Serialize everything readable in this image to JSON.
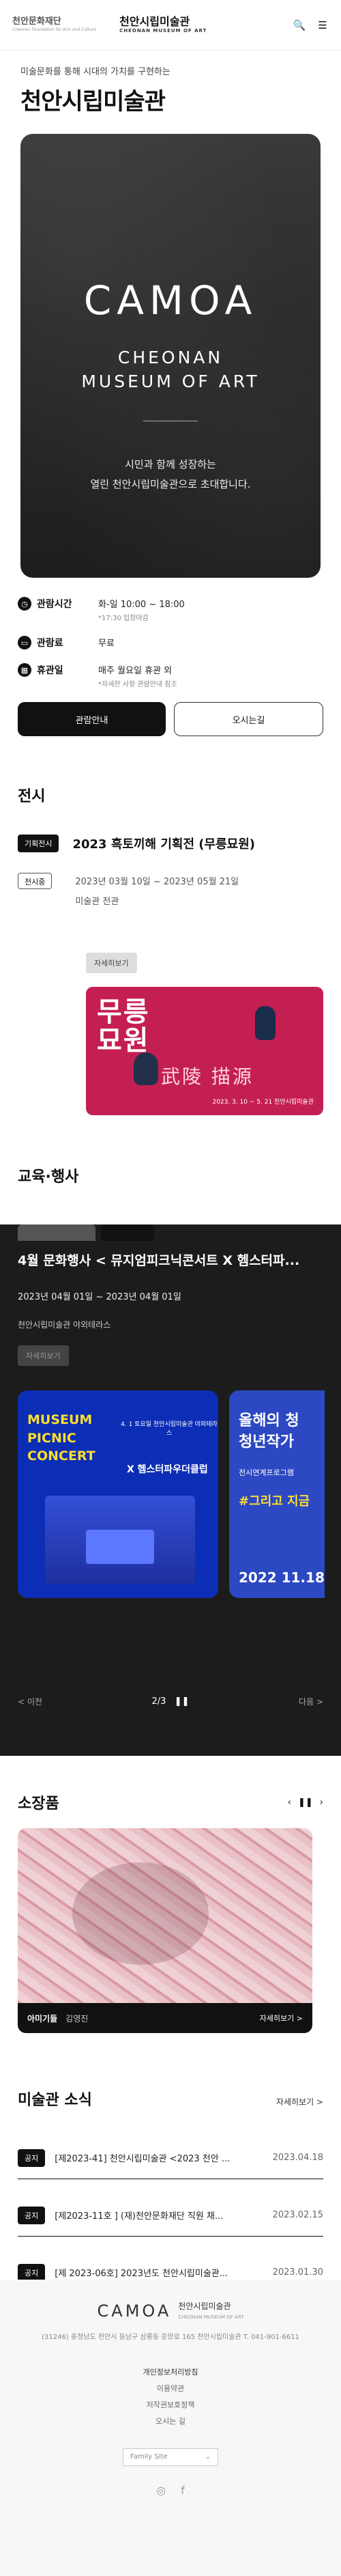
{
  "header": {
    "org_name": "천안문화재단",
    "org_sub": "Cheonan Foundation for Arts and Culture",
    "museum_name": "천안시립미술관",
    "museum_sub": "CHEONAN MUSEUM OF ART",
    "search_icon": "🔍",
    "menu_icon": "☰"
  },
  "hero": {
    "subtitle": "미술문화를 통해 시대의 가치를 구현하는",
    "title": "천안시립미술관",
    "brand": "CAMOA",
    "brand_line1": "CHEONAN",
    "brand_line2": "MUSEUM OF ART",
    "message_line1": "시민과 함께 성장하는",
    "message_line2": "열린 천안시립미술관으로 초대합니다."
  },
  "info": {
    "hours_label": "관람시간",
    "hours_value": "화-일 10:00 ~ 18:00",
    "hours_note": "*17:30 입장마감",
    "fee_label": "관람료",
    "fee_value": "무료",
    "closed_label": "휴관일",
    "closed_value": "매주 월요일 휴관 외",
    "closed_note": "*자세한 사항 관람안내 참조",
    "guide_button": "관람안내",
    "map_button": "오시는길"
  },
  "exhibition": {
    "section_title": "전시",
    "type_tag": "기획전시",
    "title": "2023 흑토끼해 기획전 (무릉묘원)",
    "status_tag": "전시중",
    "period": "2023년 03월 10일 ~ 2023년 05월 21일",
    "venue": "미술관 전관",
    "more_button": "자세히보기",
    "poster_title_line1": "무릉",
    "poster_title_line2": "묘원",
    "poster_hanja": "武陵 描源",
    "poster_info": "2023. 3. 10 ~ 5. 21 천안시립미술관"
  },
  "education": {
    "section_title": "교육·행사",
    "title": "4월 문화행사 < 뮤지엄피크닉콘서트 X 헴스터파...",
    "period": "2023년 04월 01일 ~ 2023년 04월 01일",
    "venue": "천안시립미술관 야외테라스",
    "more_button": "자세히보기",
    "slide1_title_line1": "MUSEUM",
    "slide1_title_line2": "PICNIC",
    "slide1_title_line3": "CONCERT",
    "slide1_x": "X 헴스터파우더클럽",
    "slide1_date": "4. 1 토요일 천안시립미술관 야외테라스",
    "slide2_title_line1": "올해의 청",
    "slide2_title_line2": "청년작가",
    "slide2_sub": "전시연계프로그램",
    "slide2_hashtag": "#그리고 지금",
    "slide2_date": "2022 11.18 ~",
    "prev": "< 이전",
    "pager": "2/3",
    "pause": "❚❚",
    "next": "다음 >"
  },
  "collection": {
    "section_title": "소장품",
    "prev_icon": "‹",
    "pause_icon": "❚❚",
    "next_icon": "›",
    "item_name": "아미기들",
    "item_author": "김영진",
    "more": "자세히보기 >"
  },
  "news": {
    "section_title": "미술관 소식",
    "more": "자세히보기 >",
    "items": [
      {
        "tag": "공지",
        "text": "[제2023-41] 천안시립미술관 <2023 천안 ...",
        "date": "2023.04.18"
      },
      {
        "tag": "공지",
        "text": "[제2023-11호 ] (재)천안문화재단 직원 채...",
        "date": "2023.02.15"
      },
      {
        "tag": "공지",
        "text": "[제 2023-06호] 2023년도 천안시립미술관...",
        "date": "2023.01.30"
      }
    ]
  },
  "footer": {
    "brand": "CAMOA",
    "brand_name": "천안시립미술관",
    "brand_sub": "CHEONAN MUSEUM OF ART",
    "address": "(31246) 충청남도 천안시 동남구 삼룡동 중앙로 165 천안시립미술관   T. 041-901-6611",
    "link1": "개인정보처리방침",
    "link2": "이용약관",
    "link3": "저작권보호정책",
    "link4": "오시는 길",
    "family_site": "Family Site",
    "family_arrow": "⌄",
    "instagram_icon": "◎",
    "facebook_icon": "f"
  }
}
